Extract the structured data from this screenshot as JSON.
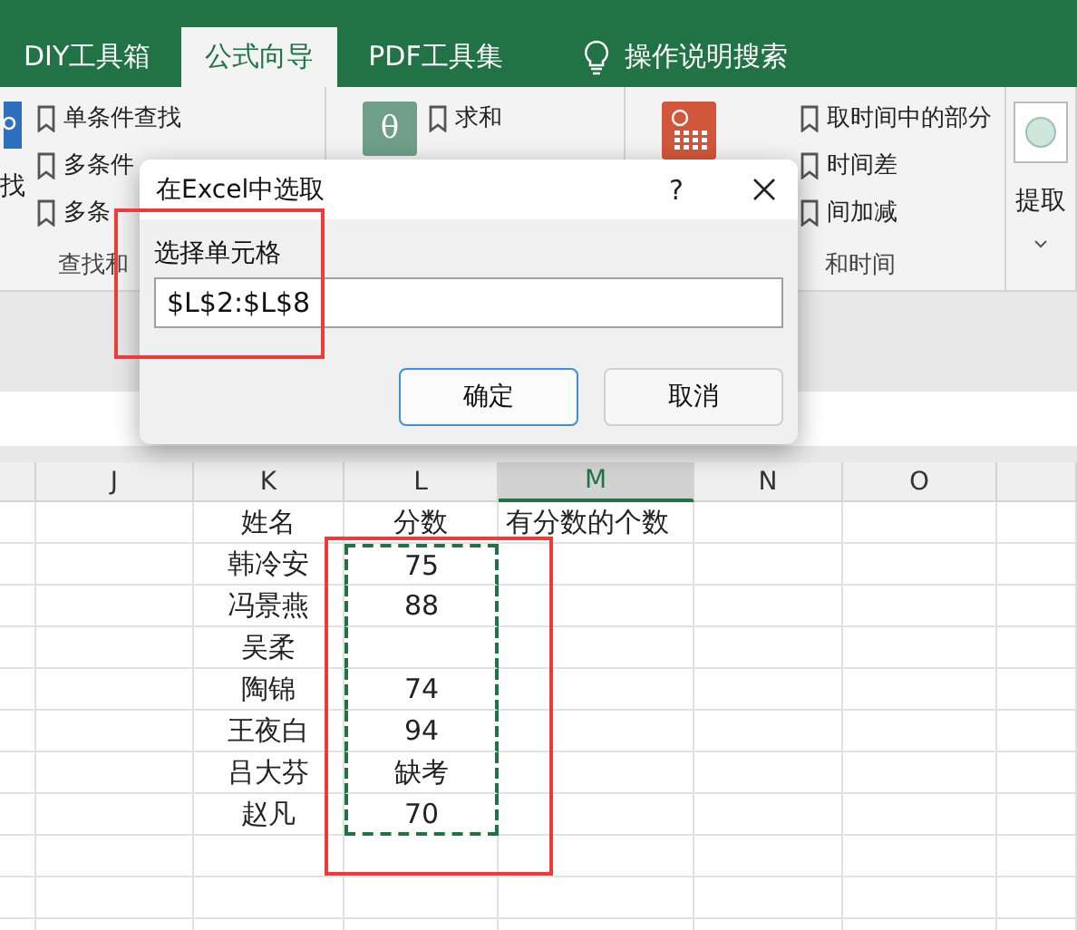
{
  "tabs": [
    {
      "label": "DIY工具箱",
      "selected": false
    },
    {
      "label": "公式向导",
      "selected": true
    },
    {
      "label": "PDF工具集",
      "selected": false
    }
  ],
  "search": {
    "label": "操作说明搜索"
  },
  "ribbon": {
    "groups": [
      {
        "kind": "search",
        "large_label": "找",
        "items": [
          "单条件查找",
          "多条件",
          "多条"
        ],
        "label": "查找和"
      },
      {
        "kind": "book",
        "glyph": "θ",
        "items": [
          "求和"
        ]
      },
      {
        "kind": "calendar",
        "items": [
          "取时间中的部分",
          "时间差",
          "间加减"
        ],
        "label": "和时间"
      },
      {
        "kind": "shape",
        "large_label": "提取"
      }
    ]
  },
  "dialog": {
    "title": "在Excel中选取",
    "help": "?",
    "field_label": "选择单元格",
    "value": "$L$2:$L$8",
    "buttons": [
      {
        "label": "确定",
        "default": true
      },
      {
        "label": "取消",
        "default": false
      }
    ]
  },
  "sheet": {
    "columns": [
      {
        "letter": "J",
        "selected": false
      },
      {
        "letter": "K",
        "selected": false
      },
      {
        "letter": "L",
        "selected": false
      },
      {
        "letter": "M",
        "selected": true
      },
      {
        "letter": "N",
        "selected": false
      },
      {
        "letter": "O",
        "selected": false
      }
    ],
    "rows": [
      {
        "name": "姓名",
        "score": "分数",
        "note": "有分数的个数",
        "copied": false
      },
      {
        "name": "韩冷安",
        "score": "75",
        "copied": true
      },
      {
        "name": "冯景燕",
        "score": "88",
        "copied": true
      },
      {
        "name": "吴柔",
        "copied": true
      },
      {
        "name": "陶锦",
        "score": "74",
        "copied": true
      },
      {
        "name": "王夜白",
        "score": "94",
        "copied": true
      },
      {
        "name": "吕大芬",
        "score": "缺考",
        "copied": true
      },
      {
        "name": "赵凡",
        "score": "70",
        "copied": true
      }
    ]
  },
  "annotations": [
    {
      "kind": "red-box"
    },
    {
      "kind": "red-box"
    }
  ]
}
